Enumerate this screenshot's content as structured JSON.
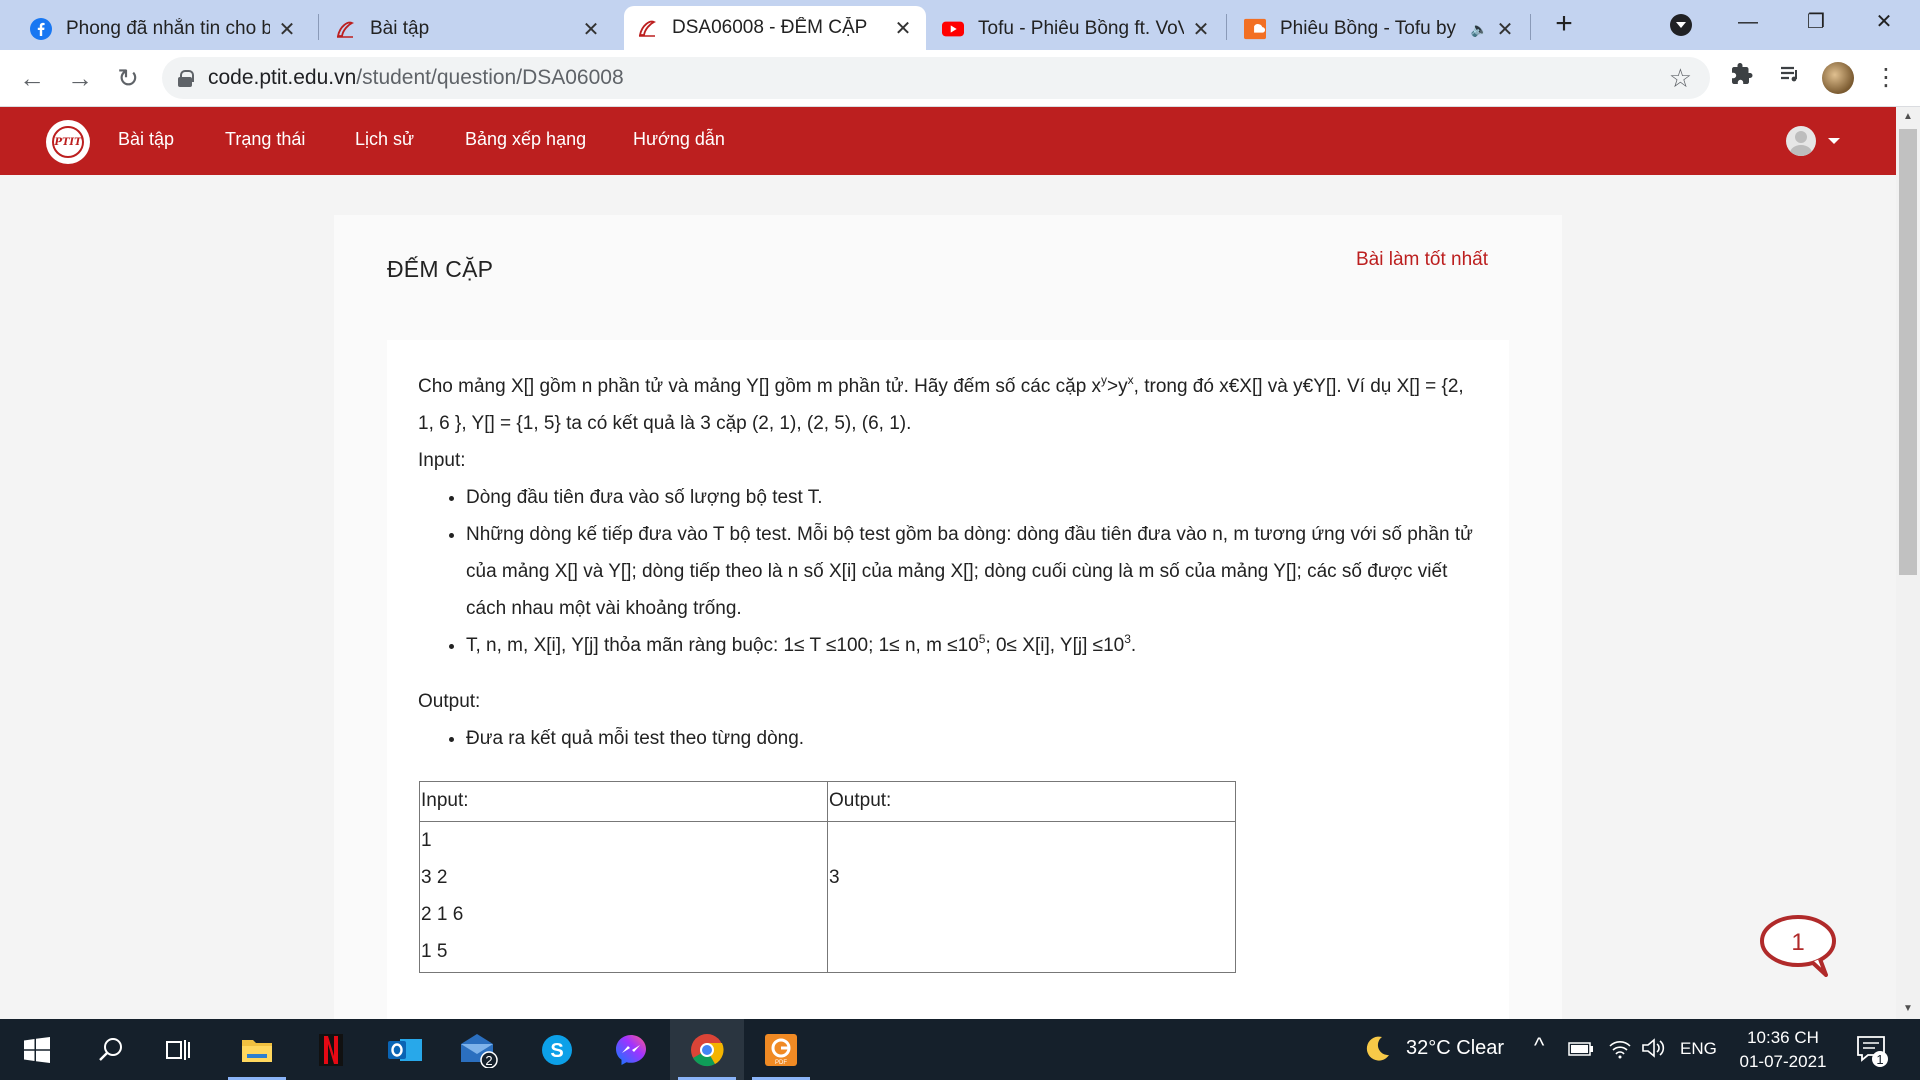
{
  "browser": {
    "tabs": [
      {
        "title": "Phong đã nhắn tin cho bạ",
        "icon": "facebook-icon",
        "active": false
      },
      {
        "title": "Bài tập",
        "icon": "ptit-icon",
        "active": false
      },
      {
        "title": "DSA06008 - ĐẾM CẶP",
        "icon": "ptit-icon",
        "active": true
      },
      {
        "title": "Tofu - Phiêu Bồng ft. VoVa",
        "icon": "youtube-icon",
        "active": false
      },
      {
        "title": "Phiêu Bồng - Tofu by",
        "icon": "soundcloud-icon",
        "active": false
      }
    ],
    "url_host": "code.ptit.edu.vn",
    "url_path": "/student/question/DSA06008"
  },
  "site": {
    "nav": [
      "Bài tập",
      "Trạng thái",
      "Lịch sử",
      "Bảng xếp hạng",
      "Hướng dẫn"
    ],
    "logo_text": "PTIT"
  },
  "problem": {
    "title": "ĐẾM CẶP",
    "best_link": "Bài làm tốt nhất",
    "intro_a": "Cho mảng X[] gồm n phần tử và mảng Y[] gồm m phần tử. Hãy đếm số các cặp x",
    "intro_sup1": "y",
    "intro_b": ">y",
    "intro_sup2": "x",
    "intro_c": ", trong đó x€X[] và y€Y[]. Ví dụ X[] = {2, 1, 6 }, Y[] = {1, 5} ta có kết quả là 3 cặp (2, 1), (2, 5), (6, 1).",
    "input_label": "Input:",
    "input_items": {
      "first": "Dòng đầu tiên đưa vào số lượng bộ test T.",
      "second": "Những dòng kế tiếp đưa vào T bộ test. Mỗi bộ test gồm ba dòng: dòng đầu tiên đưa vào n, m tương ứng với số phần tử của mảng X[] và Y[]; dòng tiếp theo là n số X[i] của mảng X[]; dòng cuối cùng là m số của mảng Y[]; các số được viết cách nhau một vài khoảng trống.",
      "third_a": "T, n, m, X[i], Y[j] thỏa mãn ràng buộc: 1≤ T ≤100; 1≤ n, m ≤10",
      "third_sup1": "5",
      "third_b": "; 0≤ X[i], Y[j] ≤10",
      "third_sup2": "3",
      "third_c": "."
    },
    "output_label": "Output:",
    "output_item": "Đưa ra kết quả mỗi test theo từng dòng.",
    "sample": {
      "input_header": "Input:",
      "output_header": "Output:",
      "input_lines": [
        "1",
        "3 2",
        "2 1 6",
        "1 5"
      ],
      "output_lines": [
        "",
        "3"
      ]
    }
  },
  "chat": {
    "badge": "1",
    "color": "#b02a2a"
  },
  "taskbar": {
    "mail_badge": "2",
    "weather": "32°C  Clear",
    "lang": "ENG",
    "time": "10:36 CH",
    "date": "01-07-2021",
    "notif_badge": "1"
  },
  "colors": {
    "brand_red": "#bc1f1f",
    "tabstrip": "#c3d3f0",
    "taskbar": "#15202b"
  }
}
